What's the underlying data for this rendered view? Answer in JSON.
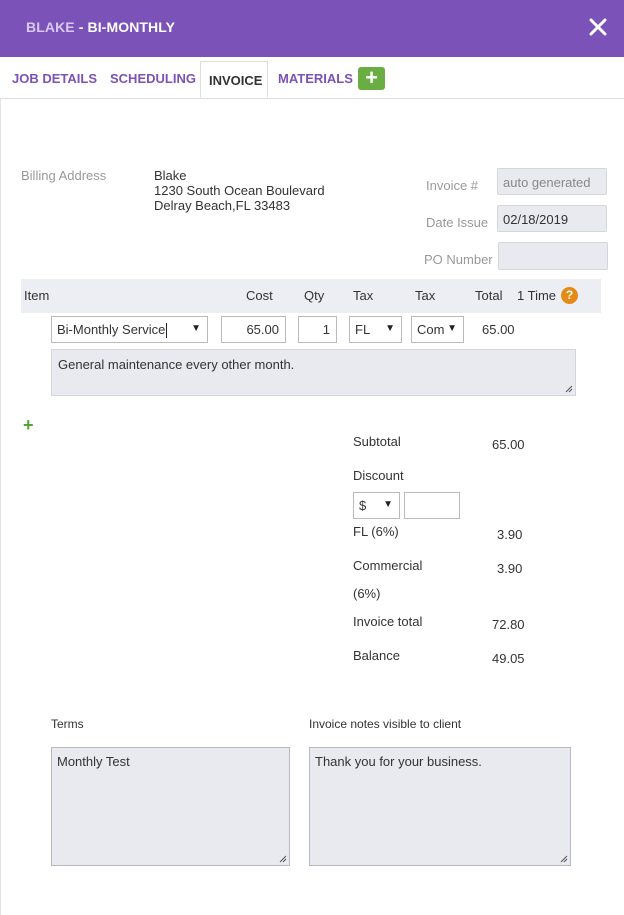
{
  "header": {
    "client": "BLAKE",
    "separator": " - ",
    "plan": "BI-MONTHLY",
    "close_icon": "close-icon"
  },
  "tabs": [
    {
      "label": "JOB DETAILS"
    },
    {
      "label": "SCHEDULING"
    },
    {
      "label": "INVOICE",
      "active": true
    },
    {
      "label": "MATERIALS"
    }
  ],
  "add_tab_icon": "+",
  "billing": {
    "label": "Billing Address",
    "name": "Blake",
    "street": "1230 South Ocean Boulevard",
    "city": "Delray Beach,FL 33483"
  },
  "invoice_meta": {
    "invoice_no_label": "Invoice #",
    "invoice_no_value": "auto generated",
    "date_label": "Date Issue",
    "date_value": "02/18/2019",
    "po_label": "PO Number",
    "po_value": ""
  },
  "grid": {
    "headers": {
      "item": "Item",
      "cost": "Cost",
      "qty": "Qty",
      "tax1": "Tax",
      "tax2": "Tax",
      "total": "Total",
      "onetime": "1 Time"
    },
    "help_icon": "?",
    "row": {
      "item": "Bi-Monthly Service",
      "cost": "65.00",
      "qty": "1",
      "tax1": "FL",
      "tax2": "Com",
      "total": "65.00",
      "description": "General maintenance every other month."
    },
    "add_line_icon": "+"
  },
  "totals": {
    "subtotal_label": "Subtotal",
    "subtotal_value": "65.00",
    "discount_label": "Discount",
    "discount_type": "$",
    "discount_value": "",
    "fl_label": "FL (6%)",
    "fl_value": "3.90",
    "commercial_label": "Commercial",
    "commercial_pct": "(6%)",
    "commercial_value": "3.90",
    "invoice_total_label": "Invoice total",
    "invoice_total_value": "72.80",
    "balance_label": "Balance",
    "balance_value": "49.05"
  },
  "footer": {
    "terms_label": "Terms",
    "terms_value": "Monthly Test",
    "notes_label": "Invoice notes visible to client",
    "notes_value": "Thank you for your business."
  }
}
